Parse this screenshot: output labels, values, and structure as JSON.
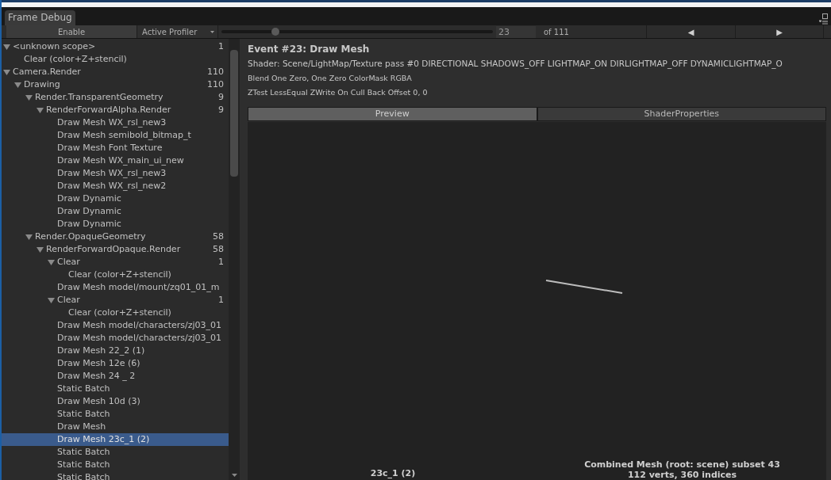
{
  "window": {
    "tab": "Frame Debug"
  },
  "toolbar": {
    "enable": "Enable",
    "profiler": "Active Profiler",
    "slider": {
      "level": 0.2
    },
    "event_index": "23",
    "event_total": "of 111",
    "prev": "◀",
    "next": "▶"
  },
  "tree": [
    {
      "label": "<unknown scope>",
      "count": "1",
      "expanded": true,
      "selected": false,
      "children": [
        {
          "label": "Clear (color+Z+stencil)",
          "selected": false
        }
      ]
    },
    {
      "label": "Camera.Render",
      "count": "110",
      "expanded": true,
      "selected": false,
      "children": [
        {
          "label": "Drawing",
          "count": "110",
          "expanded": true,
          "selected": false,
          "children": [
            {
              "label": "Render.TransparentGeometry",
              "count": "9",
              "expanded": true,
              "selected": false,
              "children": [
                {
                  "label": "RenderForwardAlpha.Render",
                  "count": "9",
                  "expanded": true,
                  "selected": false,
                  "children": [
                    {
                      "label": "Draw Mesh WX_rsl_new3",
                      "selected": false
                    },
                    {
                      "label": "Draw Mesh semibold_bitmap_t",
                      "selected": false
                    },
                    {
                      "label": "Draw Mesh Font Texture",
                      "selected": false
                    },
                    {
                      "label": "Draw Mesh WX_main_ui_new",
                      "selected": false
                    },
                    {
                      "label": "Draw Mesh WX_rsl_new3",
                      "selected": false
                    },
                    {
                      "label": "Draw Mesh WX_rsl_new2",
                      "selected": false
                    },
                    {
                      "label": "Draw Dynamic",
                      "selected": false
                    },
                    {
                      "label": "Draw Dynamic",
                      "selected": false
                    },
                    {
                      "label": "Draw Dynamic",
                      "selected": false
                    }
                  ]
                }
              ]
            },
            {
              "label": "Render.OpaqueGeometry",
              "count": "58",
              "expanded": true,
              "selected": false,
              "children": [
                {
                  "label": "RenderForwardOpaque.Render",
                  "count": "58",
                  "expanded": true,
                  "selected": false,
                  "children": [
                    {
                      "label": "Clear",
                      "count": "1",
                      "expanded": true,
                      "selected": false,
                      "children": [
                        {
                          "label": "Clear (color+Z+stencil)",
                          "selected": false
                        }
                      ]
                    },
                    {
                      "label": "Draw Mesh model/mount/zq01_01_m",
                      "selected": false
                    },
                    {
                      "label": "Clear",
                      "count": "1",
                      "expanded": true,
                      "selected": false,
                      "children": [
                        {
                          "label": "Clear (color+Z+stencil)",
                          "selected": false
                        }
                      ]
                    },
                    {
                      "label": "Draw Mesh model/characters/zj03_01",
                      "selected": false
                    },
                    {
                      "label": "Draw Mesh model/characters/zj03_01",
                      "selected": false
                    },
                    {
                      "label": "Draw Mesh 22_2 (1)",
                      "selected": false
                    },
                    {
                      "label": "Draw Mesh 12e (6)",
                      "selected": false
                    },
                    {
                      "label": "Draw Mesh 24 _ 2",
                      "selected": false
                    },
                    {
                      "label": "Static Batch",
                      "selected": false
                    },
                    {
                      "label": "Draw Mesh 10d (3)",
                      "selected": false
                    },
                    {
                      "label": "Static Batch",
                      "selected": false
                    },
                    {
                      "label": "Draw Mesh",
                      "selected": false
                    },
                    {
                      "label": "Draw Mesh 23c_1 (2)",
                      "selected": true
                    },
                    {
                      "label": "Static Batch",
                      "selected": false
                    },
                    {
                      "label": "Static Batch",
                      "selected": false
                    },
                    {
                      "label": "Static Batch",
                      "selected": false
                    }
                  ]
                }
              ]
            }
          ]
        }
      ]
    }
  ],
  "details": {
    "title": "Event #23: Draw Mesh",
    "shader": "Shader: Scene/LightMap/Texture pass #0  DIRECTIONAL SHADOWS_OFF LIGHTMAP_ON DIRLIGHTMAP_OFF DYNAMICLIGHTMAP_O",
    "blend": "Blend One Zero, One Zero ColorMask RGBA",
    "ztest": "ZTest LessEqual ZWrite On Cull Back Offset 0, 0"
  },
  "tabs": [
    {
      "label": "Preview",
      "selected": true
    },
    {
      "label": "ShaderProperties",
      "selected": false
    }
  ],
  "preview": {
    "mesh_name": "23c_1 (2)",
    "mesh_info": "Combined Mesh (root: scene) subset 43",
    "mesh_stats": "112 verts, 360 indices"
  }
}
